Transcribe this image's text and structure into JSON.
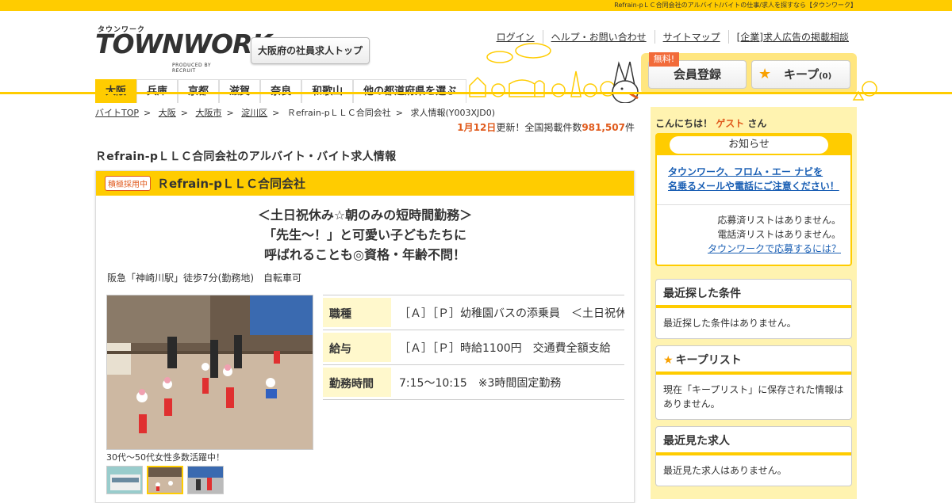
{
  "topbar": {
    "text": "Refrain-pＬＣ合同会社のアルバイト/バイトの仕事/求人を探すなら【タウンワーク】"
  },
  "logo": {
    "kana": "タウンワーク",
    "word": "TOWNWORK",
    "produced": "PRODUCED BY RECRUIT"
  },
  "header": {
    "pref_top": "大阪府の社員求人トップ",
    "links": [
      "ログイン",
      "ヘルプ・お問い合わせ",
      "サイトマップ",
      "[企業]求人広告の掲載相談"
    ],
    "member_label": "会員登録",
    "free_badge": "無料!",
    "keep_label": "キープ",
    "keep_count": "(0)"
  },
  "tabs": [
    {
      "label": "大阪",
      "active": true
    },
    {
      "label": "兵庫"
    },
    {
      "label": "京都"
    },
    {
      "label": "滋賀"
    },
    {
      "label": "奈良"
    },
    {
      "label": "和歌山"
    },
    {
      "label": "他の都道府県を選ぶ"
    }
  ],
  "breadcrumb": [
    "バイトTOP",
    "大阪",
    "大阪市",
    "淀川区",
    "Ｒefrain-pＬＬＣ合同会社",
    "求人情報(Y003XJD0)"
  ],
  "updated": {
    "date": "1月12日",
    "text1": "更新！全国掲載件数",
    "count": "981,507",
    "unit": "件"
  },
  "page_title": "Ｒefrain-pＬＬＣ合同会社のアルバイト・バイト求人情報",
  "job": {
    "badge": "積極採用中",
    "company": "Ｒefrain-pＬＬＣ合同会社",
    "catch": [
      "＜土日祝休み☆朝のみの短時間勤務＞",
      "「先生～！」と可愛い子どもたちに",
      "呼ばれることも◎資格・年齢不問！"
    ],
    "access": "阪急「神崎川駅」徒歩7分(勤務地)　自転車可",
    "caption": "30代～50代女性多数活躍中！",
    "rows": [
      {
        "th": "職種",
        "td": "［Ａ］［Ｐ］幼稚園バスの添乗員　＜土日祝休み＞"
      },
      {
        "th": "給与",
        "td": "［Ａ］［Ｐ］時給1100円　交通費全額支給"
      },
      {
        "th": "勤務時間",
        "td": "7:15～10:15　※3時間固定勤務"
      }
    ]
  },
  "sidebar": {
    "greet_pre": "こんにちは！",
    "guest": "ゲスト",
    "greet_post": "さん",
    "notice_title": "お知らせ",
    "notice_link": [
      "タウンワーク、フロム・エー ナビを",
      "名乗るメールや電話にご注意ください！"
    ],
    "notice_lines": [
      "応募済リストはありません。",
      "電話済リストはありません。"
    ],
    "notice_help": "タウンワークで応募するには？",
    "panels": [
      {
        "title": "最近探した条件",
        "body": "最近探した条件はありません。"
      },
      {
        "title": "キープリスト",
        "body": "現在「キープリスト」に保存された情報はありません。"
      },
      {
        "title": "最近見た求人",
        "body": "最近見た求人はありません。"
      }
    ]
  }
}
